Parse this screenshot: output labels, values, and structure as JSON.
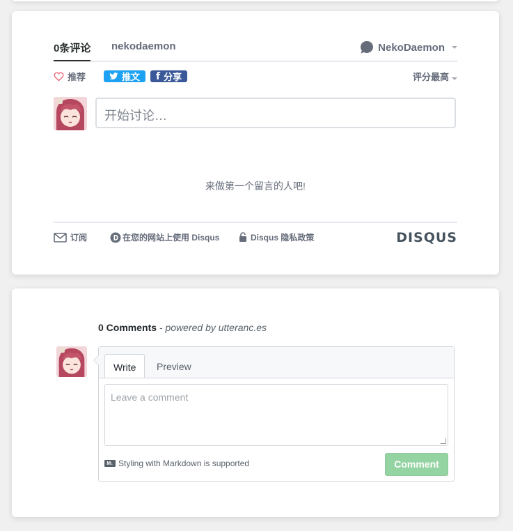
{
  "disqus": {
    "tabs": [
      {
        "label": "0条评论",
        "active": true
      },
      {
        "label": "nekodaemon",
        "active": false
      }
    ],
    "user": {
      "name": "NekoDaemon"
    },
    "actions": {
      "recommend": "推荐",
      "tweet": "推文",
      "share": "分享",
      "sort": "评分最高"
    },
    "input_placeholder": "开始讨论…",
    "empty_text": "来做第一个留言的人吧!",
    "footer": {
      "subscribe": "订阅",
      "add_disqus": "在您的网站上使用 Disqus",
      "privacy": "Disqus 隐私政策",
      "logo": "DISQUS"
    },
    "colors": {
      "twitter": "#1da1f2",
      "facebook": "#3b5998"
    }
  },
  "utterances": {
    "count_label": "0 Comments",
    "powered_by": "- powered by utteranc.es",
    "tabs": [
      {
        "label": "Write",
        "active": true
      },
      {
        "label": "Preview",
        "active": false
      }
    ],
    "textarea_placeholder": "Leave a comment",
    "markdown_note": "Styling with Markdown is supported",
    "markdown_icon": "M↓",
    "comment_button": "Comment",
    "colors": {
      "comment_button": "#94d3a2"
    }
  }
}
